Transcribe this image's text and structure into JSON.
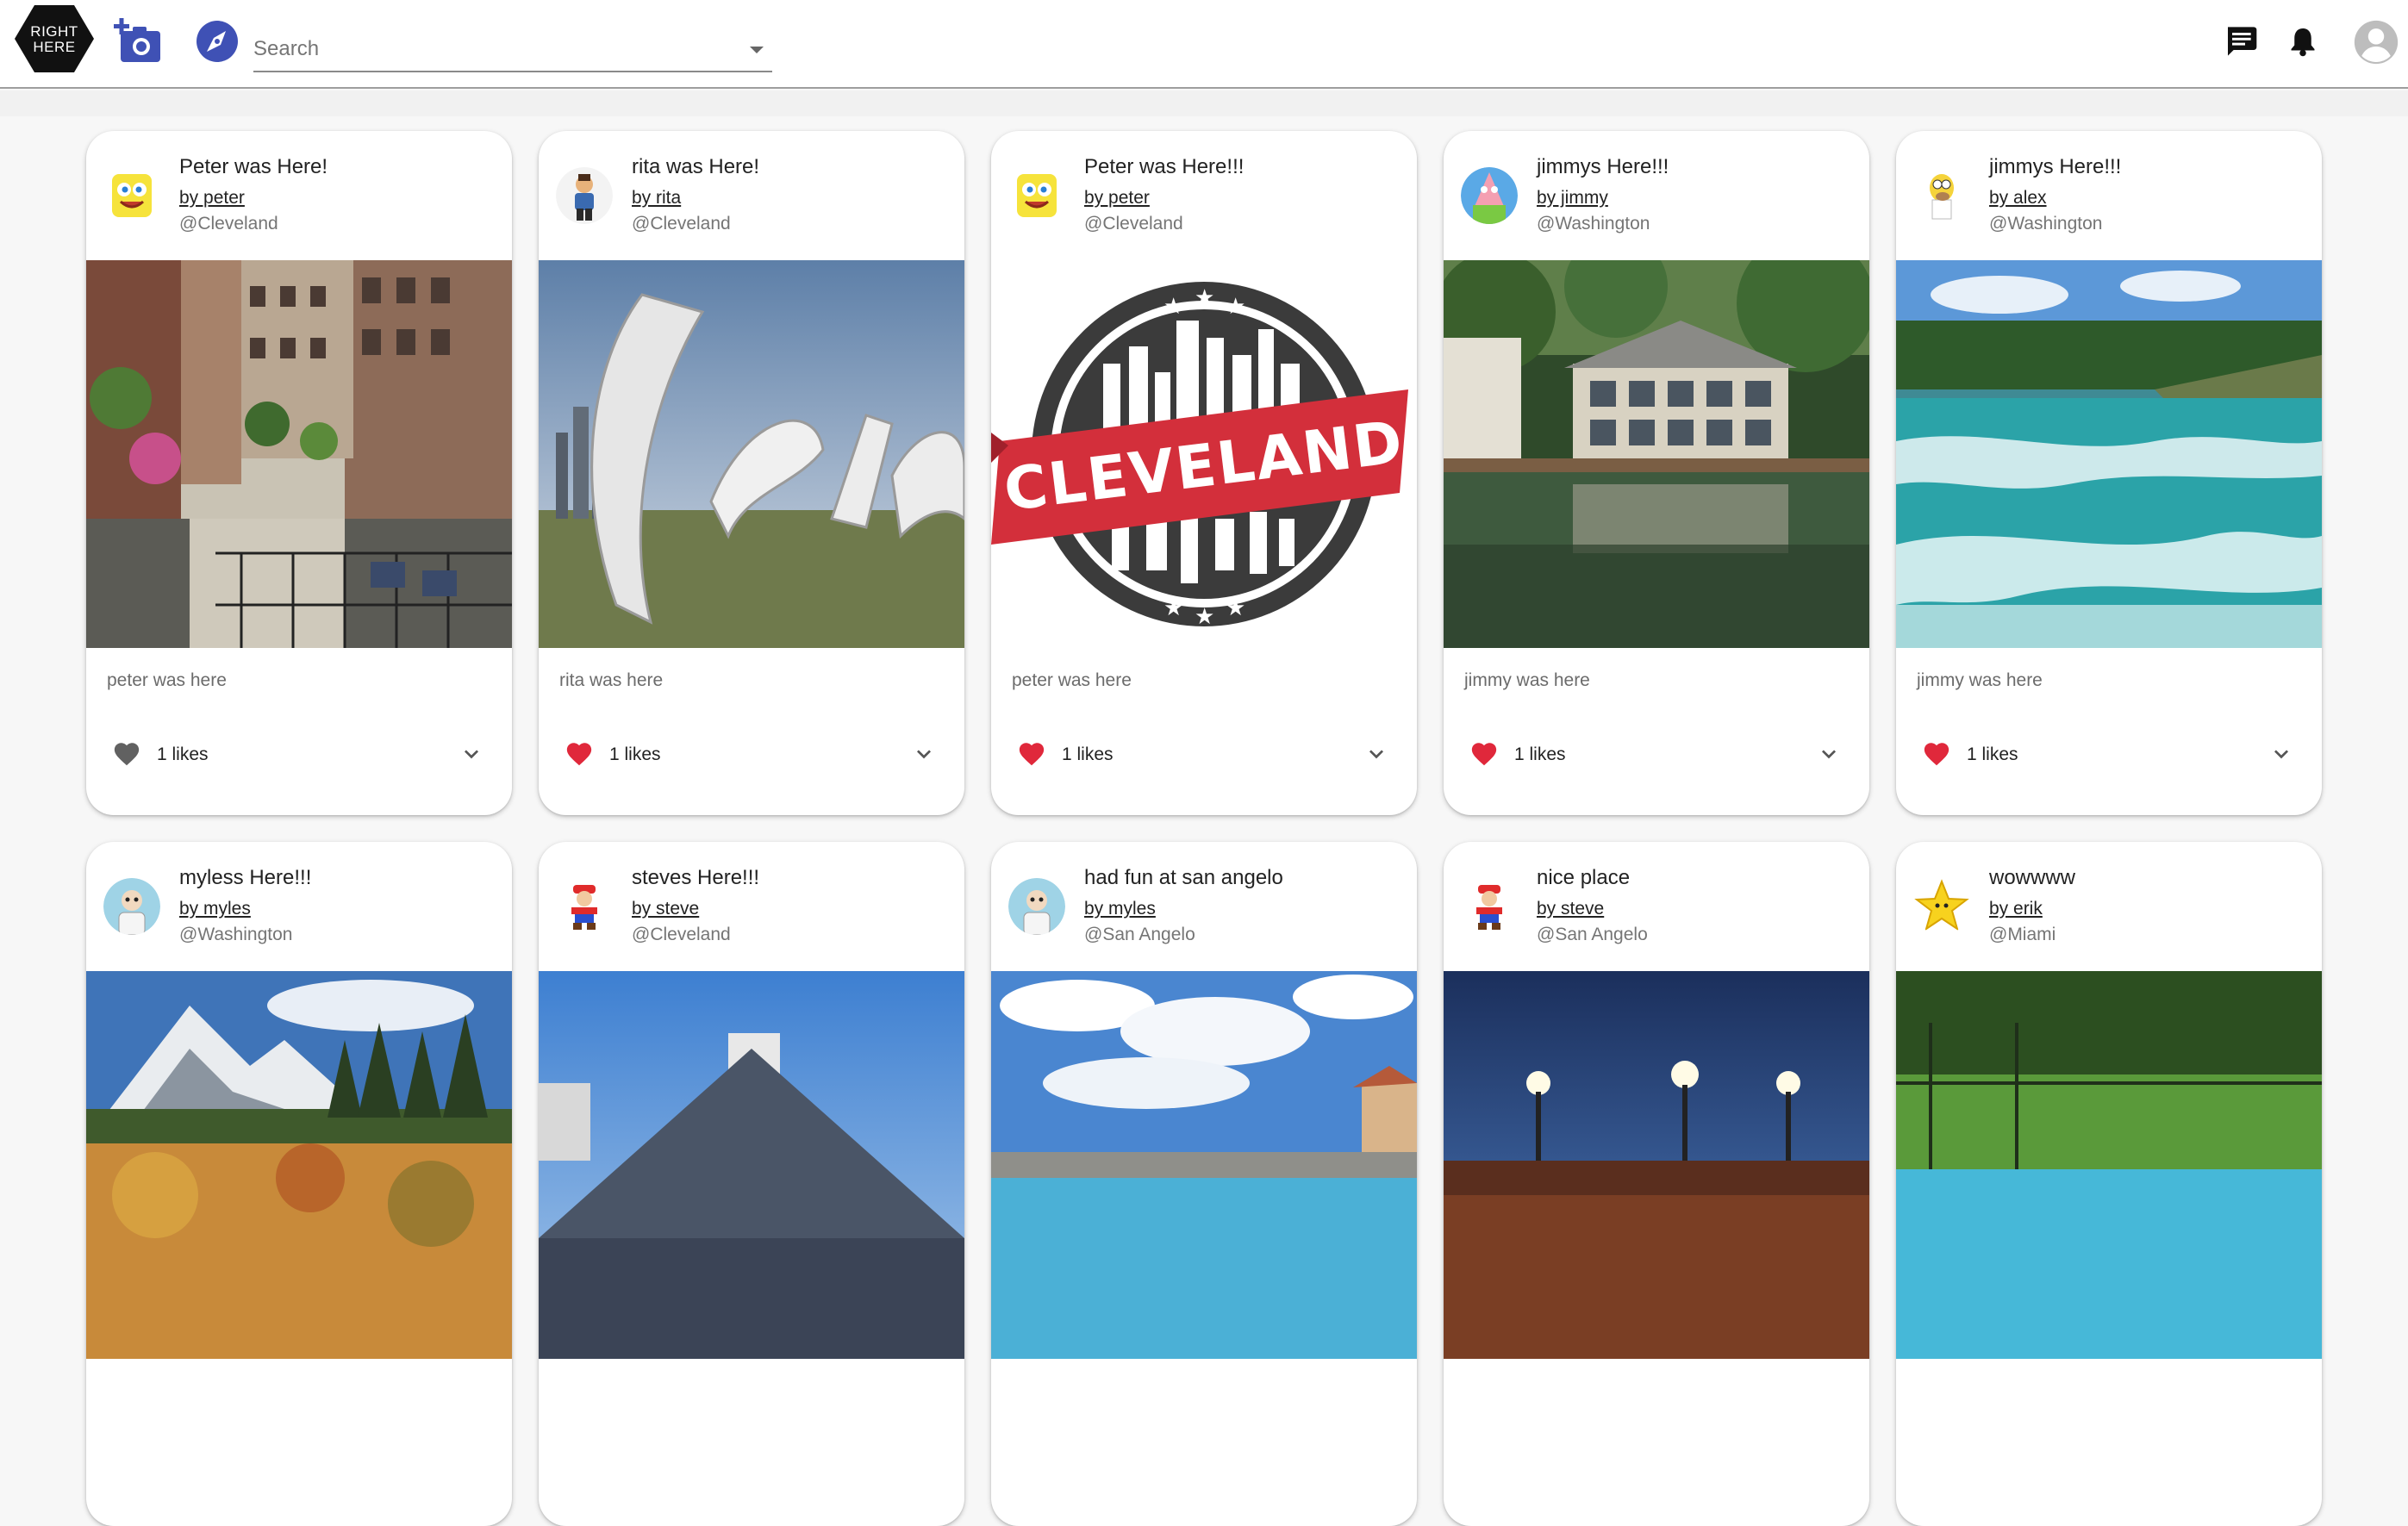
{
  "app": {
    "logo_text_line1": "RIGHT",
    "logo_text_line2": "HERE",
    "search_placeholder": "Search",
    "colors": {
      "brand_blue": "#3f51b5",
      "like_red": "#e0283b",
      "like_grey": "#616161"
    }
  },
  "posts": [
    {
      "title": "Peter was Here!",
      "author": "by peter",
      "place": "@Cleveland",
      "caption": "peter was here",
      "likes": "1 likes",
      "liked": false,
      "avatar": "spongebob-avatar",
      "photo": "cleveland-street-photo"
    },
    {
      "title": "rita was Here!",
      "author": "by rita",
      "place": "@Cleveland",
      "caption": "rita was here",
      "likes": "1 likes",
      "liked": true,
      "avatar": "cartoon-person-avatar",
      "photo": "cleveland-script-sign-photo"
    },
    {
      "title": "Peter was Here!!!",
      "author": "by peter",
      "place": "@Cleveland",
      "caption": "peter was here",
      "likes": "1 likes",
      "liked": true,
      "avatar": "spongebob-avatar",
      "photo": "cleveland-stamp-photo",
      "stamp_text": "CLEVELAND"
    },
    {
      "title": "jimmys Here!!!",
      "author": "by jimmy",
      "place": "@Washington",
      "caption": "jimmy was here",
      "likes": "1 likes",
      "liked": true,
      "avatar": "patrick-avatar",
      "photo": "lake-house-photo"
    },
    {
      "title": "jimmys Here!!!",
      "author": "by alex",
      "place": "@Washington",
      "caption": "jimmy was here",
      "likes": "1 likes",
      "liked": true,
      "avatar": "homer-avatar",
      "photo": "river-rapids-photo"
    },
    {
      "title": "myless Here!!!",
      "author": "by myles",
      "place": "@Washington",
      "caption": "",
      "likes": "",
      "liked": false,
      "avatar": "cartoon-avatar",
      "photo": "mountain-photo"
    },
    {
      "title": "steves Here!!!",
      "author": "by steve",
      "place": "@Cleveland",
      "caption": "",
      "likes": "",
      "liked": false,
      "avatar": "mario-avatar",
      "photo": "pyramid-building-photo"
    },
    {
      "title": "had fun at san angelo",
      "author": "by myles",
      "place": "@San Angelo",
      "caption": "",
      "likes": "",
      "liked": false,
      "avatar": "cartoon-avatar",
      "photo": "pool-sky-photo"
    },
    {
      "title": "nice place",
      "author": "by steve",
      "place": "@San Angelo",
      "caption": "",
      "likes": "",
      "liked": false,
      "avatar": "mario-avatar",
      "photo": "stadium-night-photo"
    },
    {
      "title": "wowwww",
      "author": "by erik",
      "place": "@Miami",
      "caption": "",
      "likes": "",
      "liked": false,
      "avatar": "star-avatar",
      "photo": "backyard-pool-photo"
    }
  ]
}
